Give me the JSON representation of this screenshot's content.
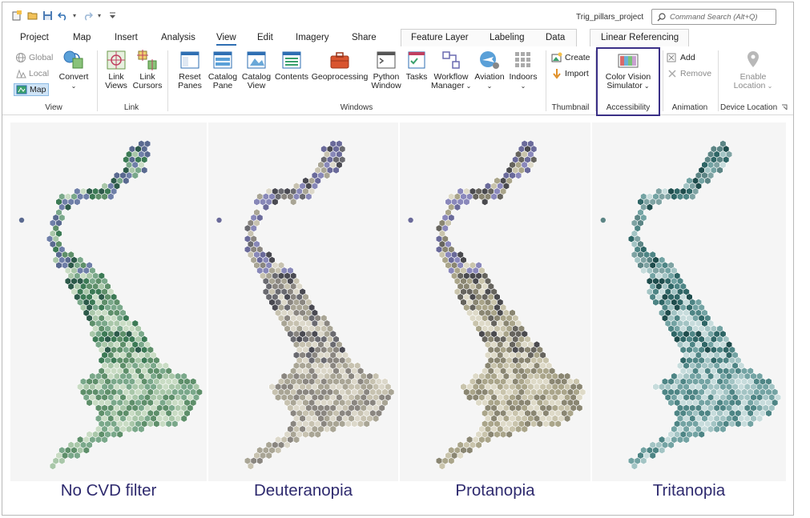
{
  "window": {
    "project_name": "Trig_pillars_project",
    "search_placeholder": "Command Search (Alt+Q)"
  },
  "tabs": [
    "Project",
    "Map",
    "Insert",
    "Analysis",
    "View",
    "Edit",
    "Imagery",
    "Share",
    "Feature Layer",
    "Labeling",
    "Data",
    "Linear Referencing"
  ],
  "active_tab": "View",
  "ribbon": {
    "view_group": {
      "label": "View",
      "global": "Global",
      "local": "Local",
      "map": "Map",
      "convert": "Convert"
    },
    "link_group": {
      "label": "Link",
      "link_views": [
        "Link",
        "Views"
      ],
      "link_cursors": [
        "Link",
        "Cursors"
      ]
    },
    "windows_group": {
      "label": "Windows",
      "reset_panes": [
        "Reset",
        "Panes"
      ],
      "catalog_pane": [
        "Catalog",
        "Pane"
      ],
      "catalog_view": [
        "Catalog",
        "View"
      ],
      "contents": "Contents",
      "geoprocessing": "Geoprocessing",
      "python_window": [
        "Python",
        "Window"
      ],
      "tasks": "Tasks",
      "workflow_manager": [
        "Workflow",
        "Manager"
      ],
      "aviation": "Aviation",
      "indoors": "Indoors"
    },
    "thumbnail_group": {
      "label": "Thumbnail",
      "create": "Create",
      "import": "Import"
    },
    "accessibility_group": {
      "label": "Accessibility",
      "cvs": [
        "Color Vision",
        "Simulator"
      ]
    },
    "animation_group": {
      "label": "Animation",
      "add": "Add",
      "remove": "Remove"
    },
    "device_location_group": {
      "label": "Device Location",
      "enable_location": [
        "Enable",
        "Location"
      ]
    }
  },
  "panels": [
    {
      "caption": "No CVD filter",
      "palette": [
        "#2d5a4a",
        "#3c7a55",
        "#5e8f6a",
        "#7aa88a",
        "#a9c7a9",
        "#c9dcc4",
        "#5a6a90",
        "#6f7fa8"
      ]
    },
    {
      "caption": "Deuteranopia",
      "palette": [
        "#4a4a52",
        "#6a6a70",
        "#8a8680",
        "#a9a595",
        "#c7c2b0",
        "#dcd8ca",
        "#6a6a9a",
        "#8888b8"
      ]
    },
    {
      "caption": "Protanopia",
      "palette": [
        "#4a4a4e",
        "#66645e",
        "#8a8672",
        "#aaa58a",
        "#c9c4ac",
        "#dedac8",
        "#6a6a9a",
        "#8a88bb"
      ]
    },
    {
      "caption": "Tritanopia",
      "palette": [
        "#1f4d4d",
        "#2f6666",
        "#4e8585",
        "#73a3a3",
        "#a3c4c4",
        "#c7dcdc",
        "#5c8585",
        "#7fa3a3"
      ]
    }
  ],
  "colors": {
    "caption": "#2e2a6e",
    "highlight_border": "#3a2f86",
    "active_tab_underline": "#2f6fb3"
  }
}
